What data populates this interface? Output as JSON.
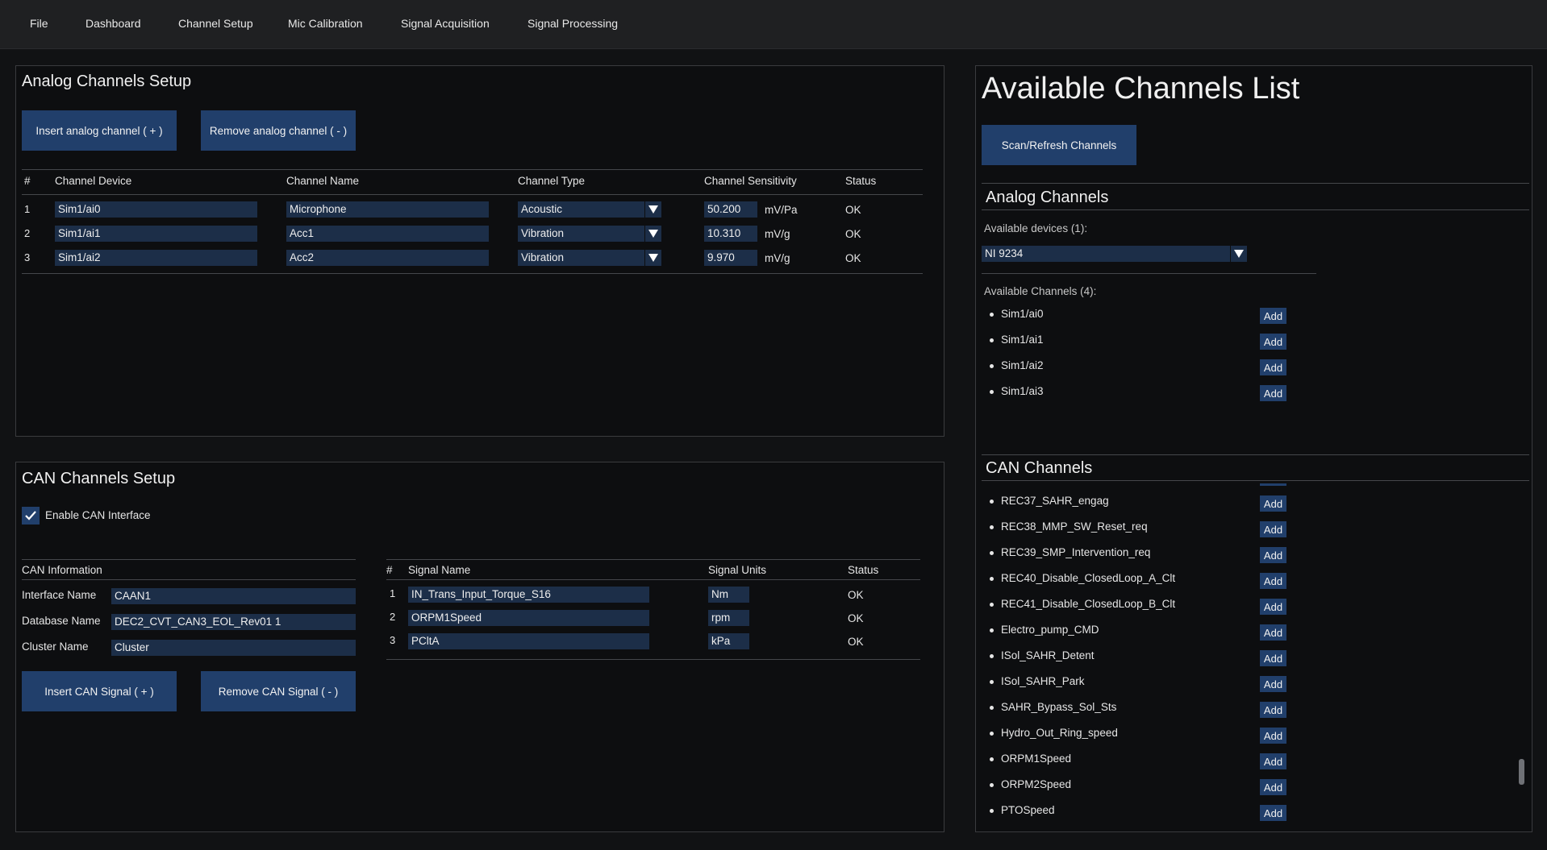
{
  "menu": [
    "File",
    "Dashboard",
    "Channel Setup",
    "Mic Calibration",
    "Signal Acquisition",
    "Signal Processing"
  ],
  "analog_setup": {
    "title": "Analog Channels Setup",
    "insert_label": "Insert analog channel ( + )",
    "remove_label": "Remove analog channel ( - )",
    "columns": [
      "#",
      "Channel Device",
      "Channel Name",
      "Channel Type",
      "Channel Sensitivity",
      "Status"
    ],
    "rows": [
      {
        "n": "1",
        "device": "Sim1/ai0",
        "name": "Microphone",
        "type": "Acoustic",
        "sens": "50.200",
        "unit": "mV/Pa",
        "status": "OK"
      },
      {
        "n": "2",
        "device": "Sim1/ai1",
        "name": "Acc1",
        "type": "Vibration",
        "sens": "10.310",
        "unit": "mV/g",
        "status": "OK"
      },
      {
        "n": "3",
        "device": "Sim1/ai2",
        "name": "Acc2",
        "type": "Vibration",
        "sens": "9.970",
        "unit": "mV/g",
        "status": "OK"
      }
    ]
  },
  "can_setup": {
    "title": "CAN Channels Setup",
    "enable_label": "Enable CAN Interface",
    "enable_checked": true,
    "info_header": "CAN Information",
    "interface_label": "Interface Name",
    "interface_value": "CAAN1",
    "database_label": "Database Name",
    "database_value": "DEC2_CVT_CAN3_EOL_Rev01 1",
    "cluster_label": "Cluster Name",
    "cluster_value": "Cluster",
    "insert_label": "Insert CAN Signal ( + )",
    "remove_label": "Remove CAN Signal ( - )",
    "columns": [
      "#",
      "Signal Name",
      "Signal Units",
      "Status"
    ],
    "rows": [
      {
        "n": "1",
        "name": "IN_Trans_Input_Torque_S16",
        "unit": "Nm",
        "status": "OK"
      },
      {
        "n": "2",
        "name": "ORPM1Speed",
        "unit": "rpm",
        "status": "OK"
      },
      {
        "n": "3",
        "name": "PCltA",
        "unit": "kPa",
        "status": "OK"
      }
    ]
  },
  "available": {
    "title": "Available Channels List",
    "scan_label": "Scan/Refresh Channels",
    "analog_title": "Analog Channels",
    "devices_label": "Available devices (1):",
    "device_selected": "NI 9234",
    "channels_label": "Available Channels (4):",
    "channels": [
      "Sim1/ai0",
      "Sim1/ai1",
      "Sim1/ai2",
      "Sim1/ai3"
    ],
    "add_label": "Add",
    "can_title": "CAN Channels",
    "can_signals": [
      "REC37_SAHR_engag",
      "REC38_MMP_SW_Reset_req",
      "REC39_SMP_Intervention_req",
      "REC40_Disable_ClosedLoop_A_Clt",
      "REC41_Disable_ClosedLoop_B_Clt",
      "Electro_pump_CMD",
      "ISol_SAHR_Detent",
      "ISol_SAHR_Park",
      "SAHR_Bypass_Sol_Sts",
      "Hydro_Out_Ring_speed",
      "ORPM1Speed",
      "ORPM2Speed",
      "PTOSpeed"
    ]
  }
}
